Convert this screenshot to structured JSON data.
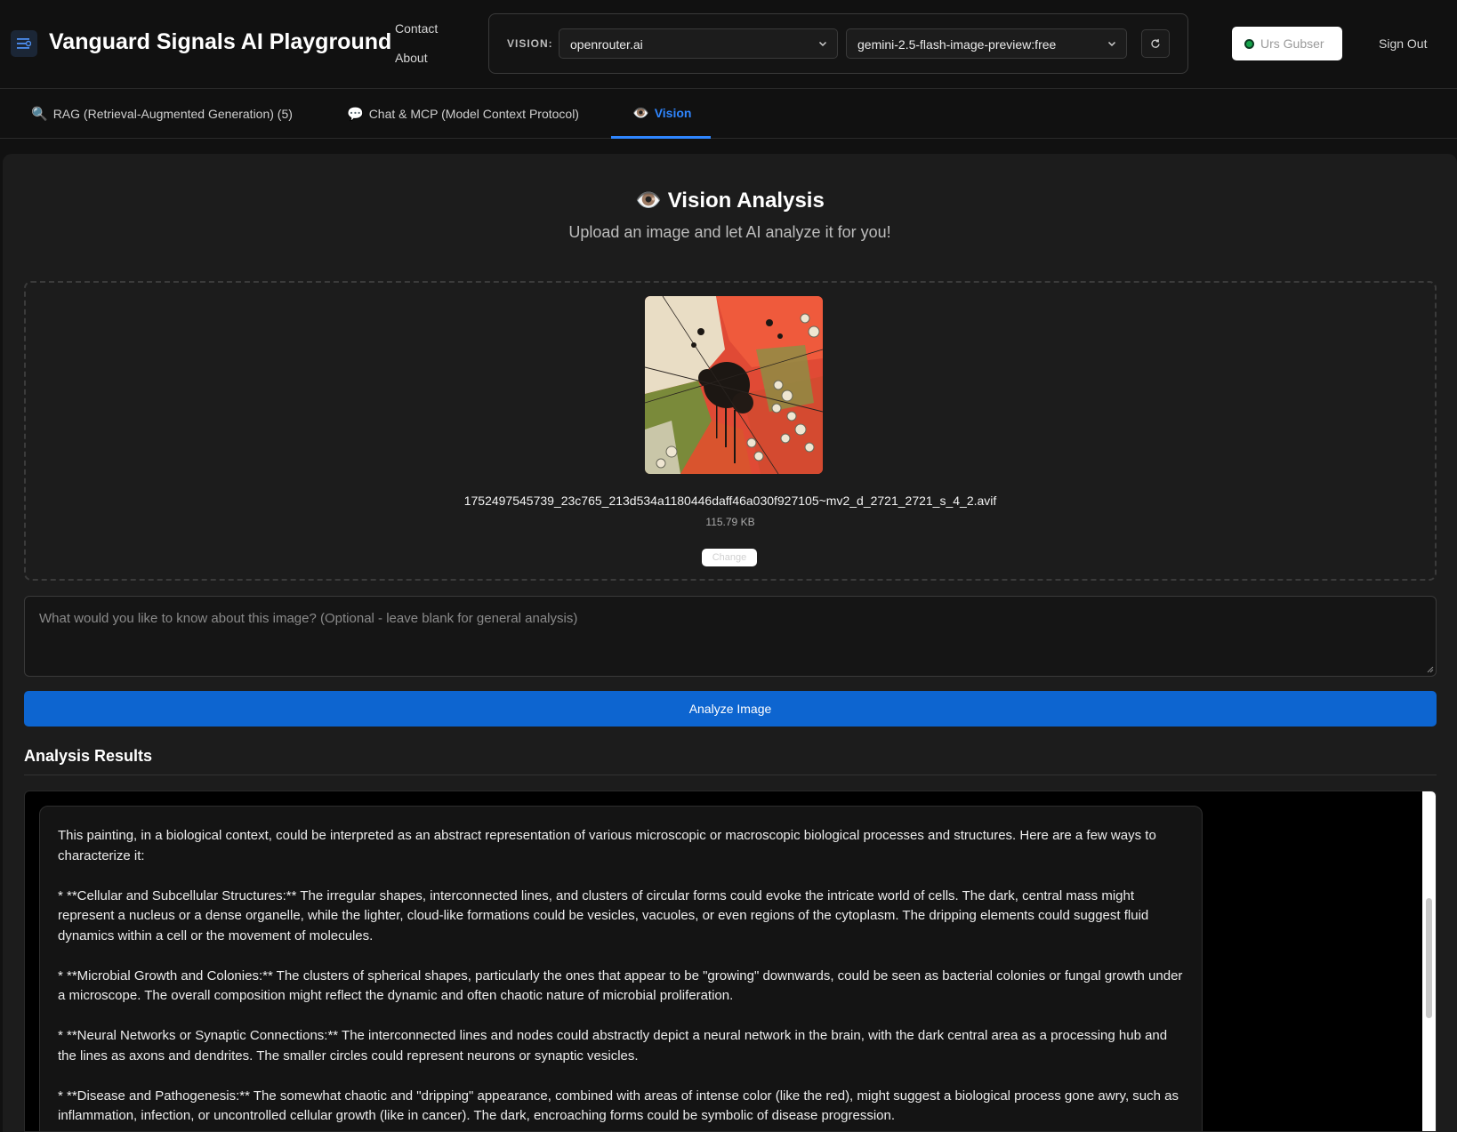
{
  "header": {
    "app_title": "Vanguard Signals AI Playground",
    "nav": {
      "contact": "Contact",
      "about": "About"
    },
    "vision_label": "VISION:",
    "provider_value": "openrouter.ai",
    "model_value": "gemini-2.5-flash-image-preview:free",
    "user_name": "Urs Gubser",
    "sign_out": "Sign Out"
  },
  "tabs": [
    {
      "icon": "🔍",
      "label": "RAG (Retrieval-Augmented Generation) (5)"
    },
    {
      "icon": "💬",
      "label": "Chat & MCP (Model Context Protocol)"
    },
    {
      "icon": "👁️",
      "label": "Vision"
    }
  ],
  "vision": {
    "title_icon": "👁️",
    "title": "Vision Analysis",
    "subtitle": "Upload an image and let AI analyze it for you!",
    "file_name": "1752497545739_23c765_213d534a1180446daff46a030f927105~mv2_d_2721_2721_s_4_2.avif",
    "file_size": "115.79 KB",
    "change_label": "Change",
    "question_placeholder": "What would you like to know about this image? (Optional - leave blank for general analysis)",
    "analyze_label": "Analyze Image",
    "results_heading": "Analysis Results",
    "result_paragraphs": [
      "This painting, in a biological context, could be interpreted as an abstract representation of various microscopic or macroscopic biological processes and structures. Here are a few ways to characterize it:",
      "*   **Cellular and Subcellular Structures:** The irregular shapes, interconnected lines, and clusters of circular forms could evoke the intricate world of cells. The dark, central mass might represent a nucleus or a dense organelle, while the lighter, cloud-like formations could be vesicles, vacuoles, or even regions of the cytoplasm. The dripping elements could suggest fluid dynamics within a cell or the movement of molecules.",
      "*   **Microbial Growth and Colonies:** The clusters of spherical shapes, particularly the ones that appear to be \"growing\" downwards, could be seen as bacterial colonies or fungal growth under a microscope. The overall composition might reflect the dynamic and often chaotic nature of microbial proliferation.",
      "*   **Neural Networks or Synaptic Connections:** The interconnected lines and nodes could abstractly depict a neural network in the brain, with the dark central area as a processing hub and the lines as axons and dendrites. The smaller circles could represent neurons or synaptic vesicles.",
      "*   **Disease and Pathogenesis:** The somewhat chaotic and \"dripping\" appearance, combined with areas of intense color (like the red), might suggest a biological process gone awry, such as inflammation, infection, or uncontrolled cellular growth (like in cancer). The dark, encroaching forms could be symbolic of disease progression."
    ]
  },
  "icons": {
    "menu": "menu-icon",
    "chevron": "chevron-down-icon",
    "refresh": "refresh-icon",
    "status": "online-status-icon"
  },
  "colors": {
    "accent": "#0d65d0",
    "tab_active": "#2f86ff",
    "status_online": "#16a34a"
  }
}
